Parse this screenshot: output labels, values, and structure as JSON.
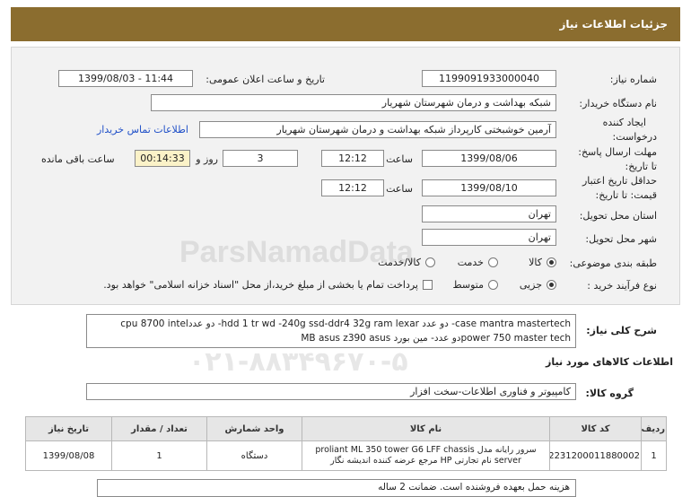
{
  "header": {
    "title": "جزئیات اطلاعات نیاز"
  },
  "form": {
    "need_number_label": "شماره نیاز:",
    "need_number": "1199091933000040",
    "announce_label": "تاریخ و ساعت اعلان عمومی:",
    "announce_value": "1399/08/03 - 11:44",
    "buyer_label": "نام دستگاه خریدار:",
    "buyer_value": "شبکه بهداشت و درمان شهرستان شهریار",
    "creator_label_1": "ایجاد کننده",
    "creator_label_2": "درخواست:",
    "creator_value": "آرمین خوشبختی کارپرداز شبکه بهداشت و درمان شهرستان شهریار",
    "contact_link": "اطلاعات تماس خریدار",
    "reply_deadline_label_1": "مهلت ارسال پاسخ:",
    "reply_deadline_label_2": "تا تاریخ:",
    "reply_date": "1399/08/06",
    "time_label": "ساعت",
    "reply_time": "12:12",
    "days_value": "3",
    "days_label": "روز و",
    "remaining_time": "00:14:33",
    "remaining_label": "ساعت باقی مانده",
    "validity_label_1": "حداقل تاریخ اعتبار",
    "validity_label_2": "قیمت: تا تاریخ:",
    "validity_date": "1399/08/10",
    "validity_time": "12:12",
    "province_label": "استان محل تحویل:",
    "province_value": "تهران",
    "city_label": "شهر محل تحویل:",
    "city_value": "تهران",
    "category_label": "طبقه بندی موضوعی:",
    "category_options": [
      "کالا",
      "خدمت",
      "کالا/خدمت"
    ],
    "category_selected": "کالا",
    "process_label": "نوع فرآیند خرید :",
    "process_options": [
      "جزیی",
      "متوسط"
    ],
    "process_selected": "جزیی",
    "payment_note": "پرداخت تمام یا بخشی از مبلغ خرید،از محل \"اسناد خزانه اسلامی\" خواهد بود."
  },
  "description": {
    "label": "شرح کلی نیاز:",
    "line1": "case mantra mastertech- دو عدد hdd 1 tr wd -240g ssd-ddr4 32g ram lexar- دو عددcpu 8700 intel",
    "line2": "power 750 master techدو عدد- مین بورد MB asus z390 asus"
  },
  "watermark": {
    "brand": "ParsNamadData",
    "line": "پایگاه اطلاع رسانی مناقصه و مزایده",
    "phone": "۰۲۱-۸۸۳۴۹۶۷۰-۵"
  },
  "goods": {
    "section_title": "اطلاعات کالاهای مورد نیاز",
    "group_label": "گروه کالا:",
    "group_value": "کامپیوتر و فناوری اطلاعات-سخت افزار",
    "columns": [
      "ردیف",
      "کد کالا",
      "نام کالا",
      "واحد شمارش",
      "تعداد / مقدار",
      "تاریخ نیاز"
    ],
    "rows": [
      {
        "index": "1",
        "code": "2231200011880002",
        "name_line1": "سرور رایانه مدل proliant ML 350 tower G6 LFF chassis",
        "name_line2": "server نام تجارتی HP مرجع عرضه کننده اندیشه نگار",
        "unit": "دستگاه",
        "qty": "1",
        "date": "1399/08/08"
      }
    ],
    "partial_text": "هزینه حمل بعهده فروشنده است. ضمانت 2 ساله"
  },
  "colors": {
    "header_bg": "#8b6d2f",
    "panel_bg": "#f2f2f2",
    "link": "#2050c8",
    "remaining_bg": "#fbf2c8"
  }
}
